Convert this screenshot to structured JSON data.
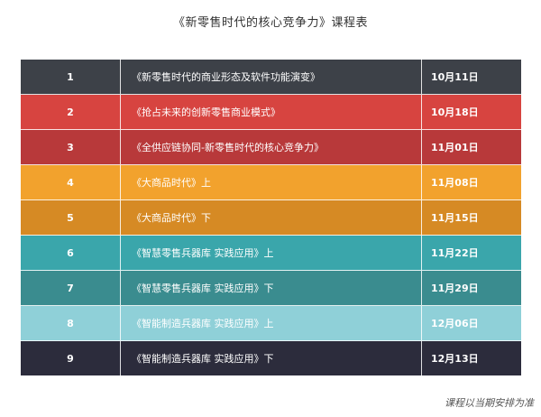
{
  "title": "《新零售时代的核心竞争力》课程表",
  "rows": [
    {
      "num": "1",
      "course": "《新零售时代的商业形态及软件功能演变》",
      "date": "10月11日",
      "color": "#3d4148"
    },
    {
      "num": "2",
      "course": "《抢占未来的创新零售商业模式》",
      "date": "10月18日",
      "color": "#d74440"
    },
    {
      "num": "3",
      "course": "《全供应链协同-新零售时代的核心竞争力》",
      "date": "11月01日",
      "color": "#b8393a"
    },
    {
      "num": "4",
      "course": "《大商品时代》上",
      "date": "11月08日",
      "color": "#f2a22d"
    },
    {
      "num": "5",
      "course": "《大商品时代》下",
      "date": "11月15日",
      "color": "#d68a24"
    },
    {
      "num": "6",
      "course": "《智慧零售兵器库 实践应用》上",
      "date": "11月22日",
      "color": "#3aa6ab"
    },
    {
      "num": "7",
      "course": "《智慧零售兵器库 实践应用》下",
      "date": "11月29日",
      "color": "#3a8c8f"
    },
    {
      "num": "8",
      "course": "《智能制造兵器库 实践应用》上",
      "date": "12月06日",
      "color": "#8fd0d8"
    },
    {
      "num": "9",
      "course": "《智能制造兵器库 实践应用》下",
      "date": "12月13日",
      "color": "#2c2c3c"
    }
  ],
  "footnote": "课程以当期安排为准"
}
